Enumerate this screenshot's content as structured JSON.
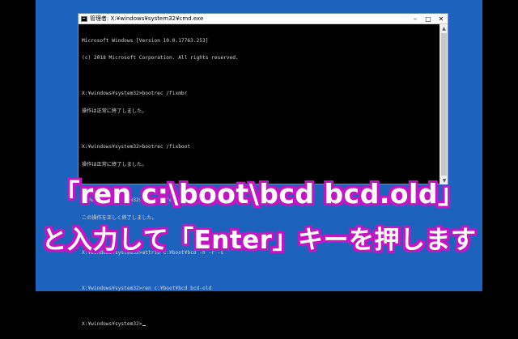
{
  "window": {
    "title": "管理者: X:¥windows¥system32¥cmd.exe",
    "minimize_label": "–",
    "maximize_label": "□",
    "close_label": "✕"
  },
  "console": {
    "lines": [
      "Microsoft Windows [Version 10.0.17763.253]",
      "(c) 2018 Microsoft Corporation. All rights reserved.",
      "",
      "X:¥windows¥system32>bootrec /fixmbr",
      "操作は正常に終了しました。",
      "",
      "X:¥windows¥system32>bootrec /fixboot",
      "操作は正常に終了しました。",
      "",
      "X:¥windows¥system32>bcdedit /export c:¥bcdbackup",
      "この操作を正しく終了しました。",
      "",
      "X:¥windows¥system32>attrib c:¥boot¥bcd -h -r -s",
      "",
      "X:¥windows¥system32>ren c:¥boot¥bcd bcd-old",
      "",
      "X:¥windows¥system32>"
    ]
  },
  "caption": {
    "line1": "「ren c:\\boot\\bcd bcd.old」",
    "line2": "と入力して「Enter」キーを押します"
  },
  "colors": {
    "desktop": "#1d63bd",
    "caption_outline": "#c316c3",
    "console_text": "#d6d6d6"
  }
}
